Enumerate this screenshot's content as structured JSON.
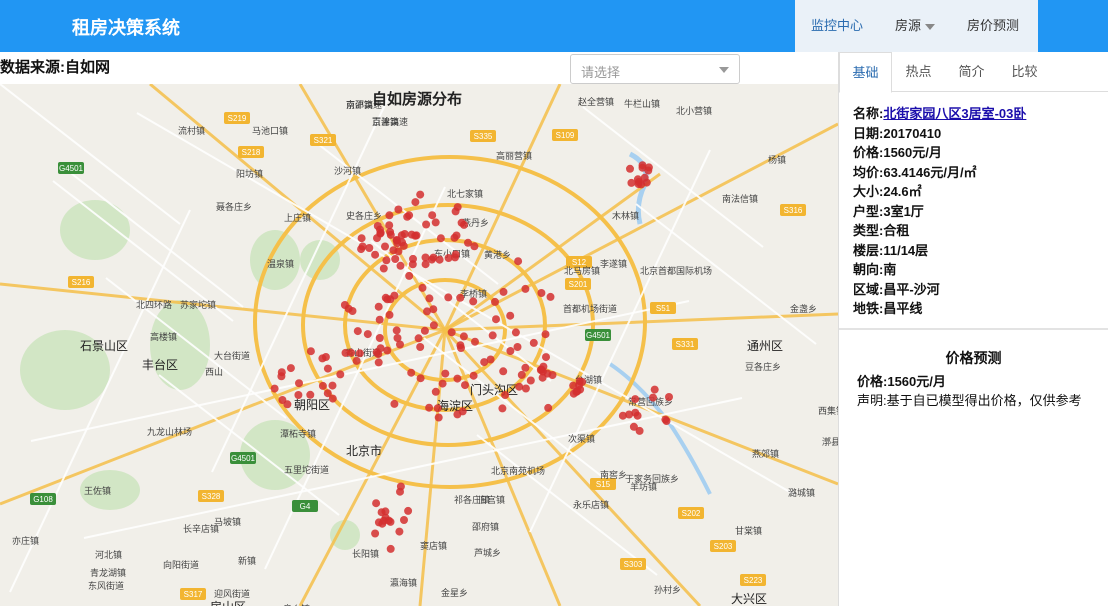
{
  "app": {
    "title": "租房决策系统"
  },
  "nav": {
    "items": [
      "监控中心",
      "房源",
      "房价预测"
    ]
  },
  "source_label": "数据来源:自如网",
  "select": {
    "placeholder": "请选择"
  },
  "map": {
    "title": "自如房源分布",
    "labels": [
      "南邵镇",
      "百善镇",
      "流村镇",
      "马池口镇",
      "沙河镇",
      "北七家镇",
      "东小口镇",
      "燕丹乡",
      "黄港乡",
      "阳坊镇",
      "聂各庄乡",
      "上庄镇",
      "史各庄乡",
      "温泉镇",
      "苏家坨镇",
      "赵全营镇",
      "牛栏山镇",
      "北小营镇",
      "杨镇",
      "南法信镇",
      "高丽营镇",
      "木林镇",
      "李遂镇",
      "北马房镇",
      "北京首都国际机场",
      "首都机场街道",
      "李桥镇",
      "金盏乡",
      "北四环路",
      "高楼镇",
      "西山",
      "香山街道",
      "门头沟区",
      "海淀区",
      "朝阳区",
      "北京市",
      "石景山区",
      "丰台区",
      "大台街道",
      "九龙山林场",
      "五里坨街道",
      "潭柘寺镇",
      "王佐镇",
      "长辛店镇",
      "河北镇",
      "青龙湖镇",
      "东风街道",
      "向阳街道",
      "迎风街道",
      "新镇",
      "良乡镇",
      "房山区",
      "长阳镇",
      "窦店镇",
      "芦城乡",
      "金星乡",
      "瀛海镇",
      "孙村乡",
      "大兴区",
      "于家务回族乡",
      "永乐店镇",
      "台湖镇",
      "次渠镇",
      "常营回族乡",
      "豆各庄乡",
      "通州区",
      "燕郊镇",
      "潞城镇",
      "甘棠镇",
      "西集镇",
      "漷县镇",
      "邵府镇",
      "祁各庄镇",
      "北京南苑机场",
      "旧宫镇",
      "亦庄镇",
      "马坡镇",
      "南窖乡",
      "羊坊镇",
      "京沪高速",
      "京津高速"
    ],
    "roads": [
      "S219",
      "S218",
      "G4501",
      "S321",
      "S335",
      "S109",
      "S216",
      "S12",
      "S201",
      "S51",
      "G4501",
      "S331",
      "S316",
      "G4501",
      "G108",
      "G4",
      "S328",
      "S15",
      "S202",
      "S203",
      "S303",
      "S223",
      "S317"
    ]
  },
  "tabs": [
    "基础",
    "热点",
    "简介",
    "比较"
  ],
  "detail": {
    "name_label": "名称:",
    "name_value": "北街家园八区3居室-03卧",
    "date_label": "日期:",
    "date_value": "20170410",
    "price_label": "价格:",
    "price_value": "1560元/月",
    "avg_label": "均价:",
    "avg_value": "63.4146元/月/㎡",
    "size_label": "大小:",
    "size_value": "24.6㎡",
    "layout_label": "户型:",
    "layout_value": "3室1厅",
    "type_label": "类型:",
    "type_value": "合租",
    "floor_label": "楼层:",
    "floor_value": "11/14层",
    "orient_label": "朝向:",
    "orient_value": "南",
    "area_label": "区域:",
    "area_value": "昌平-沙河",
    "subway_label": "地铁:",
    "subway_value": "昌平线"
  },
  "prediction": {
    "title": "价格预测",
    "price_label": "价格:",
    "price_value": "1560元/月",
    "note_label": "声明:",
    "note_value": "基于自已模型得出价格，仅供参考"
  },
  "colors": {
    "header": "#2196f3",
    "marker": "#d32f2f",
    "road": "#f5c04a",
    "water": "#a8d0f0",
    "green": "#c5e3b5"
  }
}
